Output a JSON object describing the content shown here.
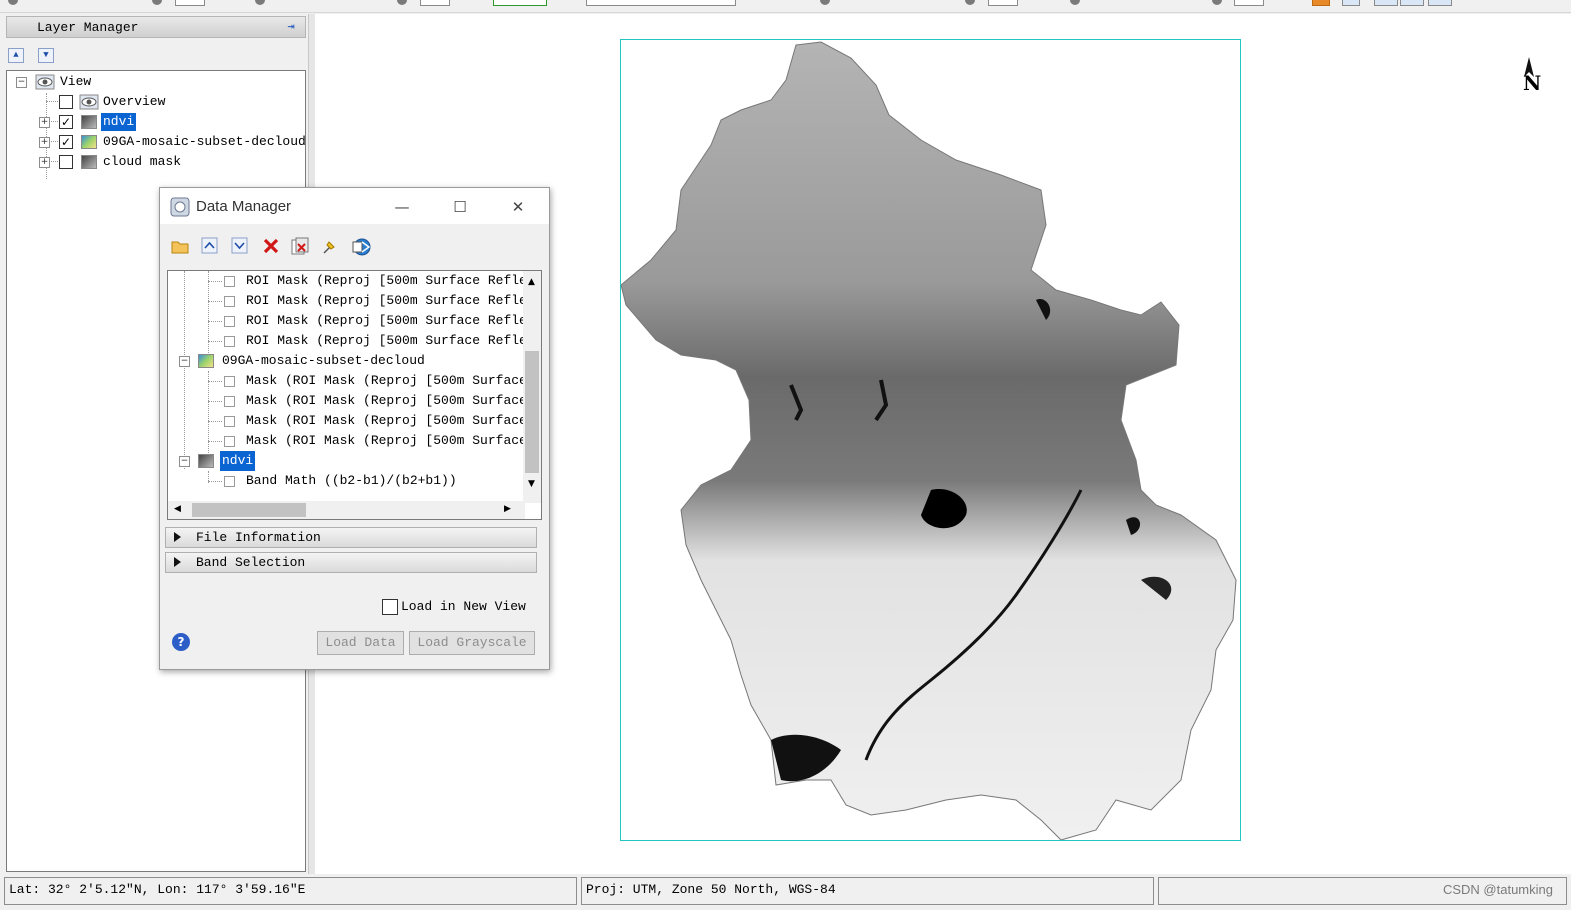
{
  "layer_manager": {
    "title": "Layer Manager",
    "tree": {
      "root_label": "View",
      "items": [
        {
          "label": "Overview",
          "checked": false,
          "selected": false,
          "icon": "overview-eye-icon"
        },
        {
          "label": "ndvi",
          "checked": true,
          "selected": true,
          "icon": "grayscale-raster-icon"
        },
        {
          "label": "09GA-mosaic-subset-decloud",
          "checked": true,
          "selected": false,
          "icon": "color-raster-icon"
        },
        {
          "label": "cloud mask",
          "checked": false,
          "selected": false,
          "icon": "grayscale-raster-icon"
        }
      ]
    }
  },
  "data_manager": {
    "title": "Data Manager",
    "tree_rows": [
      {
        "label": "ROI Mask (Reproj [500m Surface Refle",
        "level": 2
      },
      {
        "label": "ROI Mask (Reproj [500m Surface Refle",
        "level": 2
      },
      {
        "label": "ROI Mask (Reproj [500m Surface Refle",
        "level": 2
      },
      {
        "label": "ROI Mask (Reproj [500m Surface Refle",
        "level": 2
      },
      {
        "label": "09GA-mosaic-subset-decloud",
        "level": 1
      },
      {
        "label": "Mask (ROI Mask (Reproj [500m Surface",
        "level": 2
      },
      {
        "label": "Mask (ROI Mask (Reproj [500m Surface",
        "level": 2
      },
      {
        "label": "Mask (ROI Mask (Reproj [500m Surface",
        "level": 2
      },
      {
        "label": "Mask (ROI Mask (Reproj [500m Surface",
        "level": 2
      },
      {
        "label": "ndvi",
        "level": 1
      },
      {
        "label": "Band Math ((b2-b1)/(b2+b1))",
        "level": 2
      }
    ],
    "sections": {
      "file_info": "File Information",
      "band_selection": "Band Selection"
    },
    "load_in_new_view": "Load in New View",
    "load_data_label": "Load Data",
    "load_grayscale_label": "Load Grayscale"
  },
  "map": {
    "north_label": "N"
  },
  "status_bar": {
    "coords": "Lat: 32° 2'5.12\"N, Lon: 117° 3'59.16\"E",
    "projection": "Proj: UTM, Zone 50 North, WGS-84",
    "watermark": "CSDN @tatumking"
  },
  "colors": {
    "selection": "#0a64d2",
    "frame": "#25c4c4"
  }
}
